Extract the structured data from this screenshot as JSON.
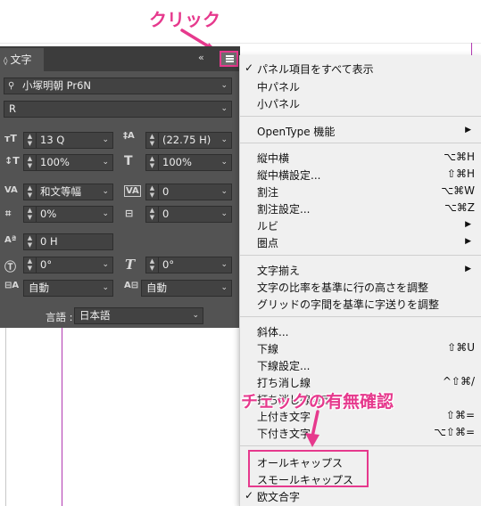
{
  "annotations": {
    "click_label": "クリック",
    "check_label": "チェックの有無確認",
    "accent_color": "#e6398d"
  },
  "panel": {
    "tab_label": "文字",
    "collapse_glyph": "«",
    "font_family": "小塚明朝 Pr6N",
    "font_style": "R",
    "font_size": "13 Q",
    "leading": "(22.75 H)",
    "vertical_scale": "100%",
    "horizontal_scale": "100%",
    "kerning": "和文等幅",
    "tracking": "0",
    "tsume": "0%",
    "aki": "0",
    "baseline_shift": "0 H",
    "rotation": "0°",
    "skew": "0°",
    "mojikumi_before": "自動",
    "mojikumi_after": "自動",
    "language_label": "言語 :",
    "language_value": "日本語"
  },
  "menu": {
    "items": [
      {
        "label": "パネル項目をすべて表示",
        "checked": true
      },
      {
        "label": "中パネル"
      },
      {
        "label": "小パネル"
      },
      {
        "label": "OpenType 機能",
        "submenu": true
      },
      {
        "label": "縦中横",
        "shortcut": "⌥⌘H"
      },
      {
        "label": "縦中横設定...",
        "shortcut": "⇧⌘H"
      },
      {
        "label": "割注",
        "shortcut": "⌥⌘W"
      },
      {
        "label": "割注設定...",
        "shortcut": "⌥⌘Z"
      },
      {
        "label": "ルビ",
        "submenu": true
      },
      {
        "label": "圏点",
        "submenu": true
      },
      {
        "label": "文字揃え",
        "submenu": true
      },
      {
        "label": "文字の比率を基準に行の高さを調整"
      },
      {
        "label": "グリッドの字間を基準に字送りを調整"
      },
      {
        "label": "斜体..."
      },
      {
        "label": "下線",
        "shortcut": "⇧⌘U"
      },
      {
        "label": "下線設定..."
      },
      {
        "label": "打ち消し線",
        "shortcut": "^⇧⌘/"
      },
      {
        "label": "打ち消し線設定..."
      },
      {
        "label": "上付き文字",
        "shortcut": "⇧⌘="
      },
      {
        "label": "下付き文字",
        "shortcut": "⌥⇧⌘="
      },
      {
        "label": "オールキャップス"
      },
      {
        "label": "スモールキャップス"
      },
      {
        "label": "欧文合字",
        "checked": true
      }
    ]
  }
}
